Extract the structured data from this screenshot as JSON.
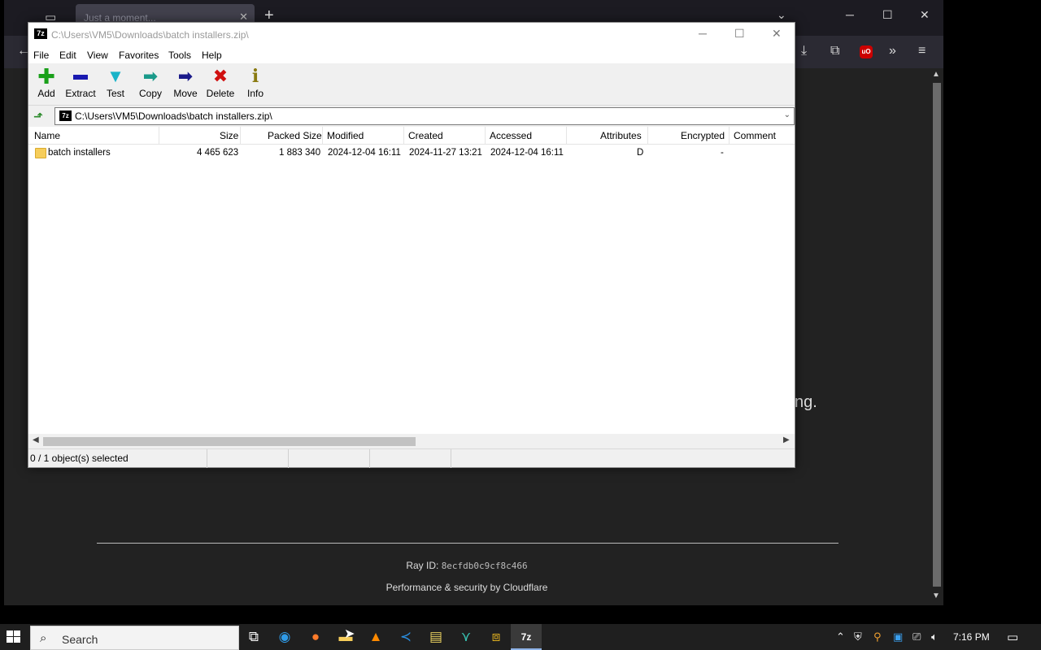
{
  "browser": {
    "tab_title": "Just a moment...",
    "new_tab_label": "+",
    "page_fragment": "ng.",
    "ray_label": "Ray ID:",
    "ray_id": "8ecfdb0c9cf8c466",
    "perf_prefix": "Performance & security by",
    "perf_brand": "Cloudflare"
  },
  "zip": {
    "title": "C:\\Users\\VM5\\Downloads\\batch installers.zip\\",
    "app_icon_text": "7z",
    "menu": [
      "File",
      "Edit",
      "View",
      "Favorites",
      "Tools",
      "Help"
    ],
    "toolbar": [
      {
        "label": "Add",
        "icon": "plus-icon",
        "color": "#1aa01a"
      },
      {
        "label": "Extract",
        "icon": "minus-icon",
        "color": "#1a1ab0"
      },
      {
        "label": "Test",
        "icon": "check-down-icon",
        "color": "#19b3c8"
      },
      {
        "label": "Copy",
        "icon": "copy-arrow-icon",
        "color": "#1a9a8a"
      },
      {
        "label": "Move",
        "icon": "move-arrow-icon",
        "color": "#1a1a8a"
      },
      {
        "label": "Delete",
        "icon": "x-icon",
        "color": "#d01010"
      },
      {
        "label": "Info",
        "icon": "info-icon",
        "color": "#8a7a10"
      }
    ],
    "address": "C:\\Users\\VM5\\Downloads\\batch installers.zip\\",
    "columns": [
      "Name",
      "Size",
      "Packed Size",
      "Modified",
      "Created",
      "Accessed",
      "Attributes",
      "Encrypted",
      "Comment"
    ],
    "rows": [
      {
        "name": "batch installers",
        "size": "4 465 623",
        "packed": "1 883 340",
        "modified": "2024-12-04 16:11",
        "created": "2024-11-27 13:21",
        "accessed": "2024-12-04 16:11",
        "attributes": "D",
        "encrypted": "-",
        "comment": ""
      }
    ],
    "status": "0 / 1 object(s) selected"
  },
  "taskbar": {
    "search_placeholder": "Search",
    "clock": "7:16 PM"
  }
}
